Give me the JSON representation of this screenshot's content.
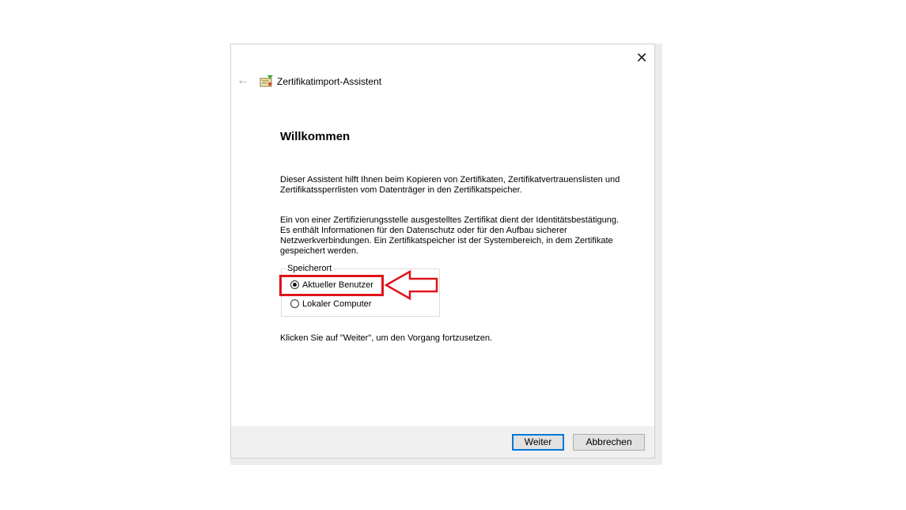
{
  "window": {
    "title": "Zertifikatimport-Assistent",
    "close_glyph": "✕",
    "back_glyph": "←"
  },
  "content": {
    "heading": "Willkommen",
    "paragraph1": "Dieser Assistent hilft Ihnen beim Kopieren von Zertifikaten, Zertifikatvertrauenslisten und Zertifikatssperrlisten vom Datenträger in den Zertifikatspeicher.",
    "paragraph2": "Ein von einer Zertifizierungsstelle ausgestelltes Zertifikat dient der Identitätsbestätigung. Es enthält Informationen für den Datenschutz oder für den Aufbau sicherer Netzwerkverbindungen. Ein Zertifikatspeicher ist der Systembereich, in dem Zertifikate gespeichert werden.",
    "storage_group": {
      "legend": "Speicherort",
      "options": [
        {
          "label": "Aktueller Benutzer",
          "selected": true
        },
        {
          "label": "Lokaler Computer",
          "selected": false
        }
      ]
    },
    "instruction": "Klicken Sie auf \"Weiter\", um den Vorgang fortzusetzen."
  },
  "footer": {
    "next_label": "Weiter",
    "cancel_label": "Abbrechen"
  },
  "colors": {
    "highlight": "#e0131b",
    "accent": "#0078d7"
  },
  "icons": {
    "wizard": "certificate-icon",
    "back": "back-arrow-icon",
    "close": "close-icon",
    "annotation": "annotation-arrow-icon"
  }
}
